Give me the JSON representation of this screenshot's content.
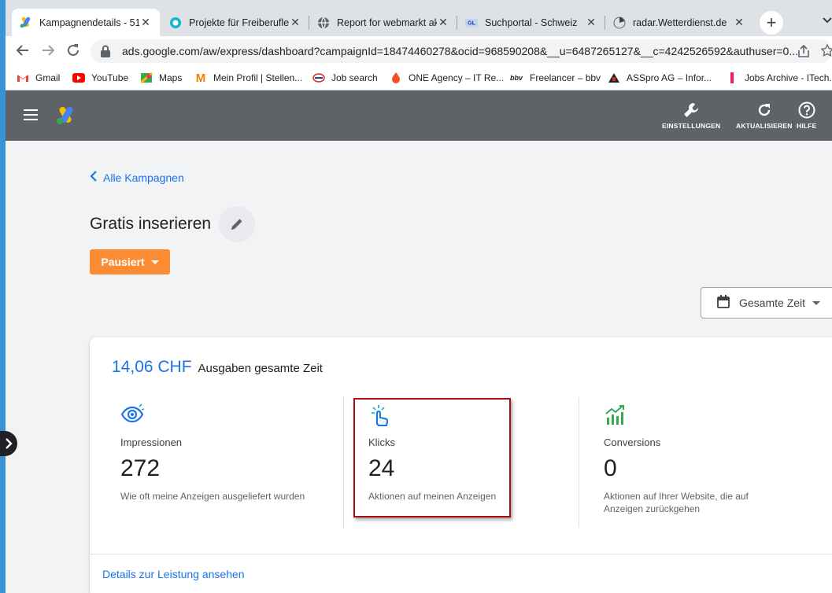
{
  "browser": {
    "tabs": [
      {
        "title": "Kampagnendetails - 51",
        "icon": "google-ads-icon",
        "active": true
      },
      {
        "title": "Projekte für Freiberufler",
        "icon": "freelance-icon",
        "active": false
      },
      {
        "title": "Report for webmarkt ak",
        "icon": "globe-icon",
        "active": false
      },
      {
        "title": "Suchportal - Schweiz",
        "icon": "portal-icon",
        "active": false
      },
      {
        "title": "radar.Wetterdienst.de",
        "icon": "radar-icon",
        "active": false
      }
    ],
    "close_glyph": "✕",
    "new_tab_glyph": "+",
    "url": "ads.google.com/aw/express/dashboard?campaignId=18474460278&ocid=968590208&__u=6487265127&__c=4242526592&authuser=0...",
    "bookmarks": [
      {
        "label": "Gmail",
        "icon": "gmail-icon"
      },
      {
        "label": "YouTube",
        "icon": "youtube-icon"
      },
      {
        "label": "Maps",
        "icon": "maps-icon"
      },
      {
        "label": "Mein Profil | Stellen...",
        "icon": "m-icon"
      },
      {
        "label": "Job search",
        "icon": "jobsearch-icon"
      },
      {
        "label": "ONE Agency – IT Re...",
        "icon": "one-agency-icon"
      },
      {
        "label": "Freelancer – bbv",
        "icon": "bbv-icon"
      },
      {
        "label": "ASSpro AG – Infor...",
        "icon": "asspro-icon"
      },
      {
        "label": "Jobs Archive - ITech...",
        "icon": "itech-icon"
      }
    ]
  },
  "appbar": {
    "actions": [
      {
        "label": "EINSTELLUNGEN",
        "icon": "wrench-icon"
      },
      {
        "label": "AKTUALISIEREN",
        "icon": "refresh-icon"
      },
      {
        "label": "HILFE",
        "icon": "help-icon"
      }
    ]
  },
  "campaign": {
    "back_label": "Alle Kampagnen",
    "title": "Gratis inserieren",
    "status": "Pausiert",
    "date_range": "Gesamte Zeit"
  },
  "summary": {
    "spend_amount": "14,06 CHF",
    "spend_label": "Ausgaben gesamte Zeit",
    "metrics": [
      {
        "label": "Impressionen",
        "value": "272",
        "description": "Wie oft meine Anzeigen ausgeliefert wurden",
        "icon": "eye-icon"
      },
      {
        "label": "Klicks",
        "value": "24",
        "description": "Aktionen auf meinen Anzeigen",
        "icon": "pointer-click-icon"
      },
      {
        "label": "Conversions",
        "value": "0",
        "description": "Aktionen auf Ihrer Website, die auf Anzeigen zurückgehen",
        "icon": "chart-up-icon"
      }
    ],
    "details_link": "Details zur Leistung ansehen"
  },
  "colors": {
    "accent_blue": "#1a73e8",
    "status_orange": "#fb8c33",
    "appbar_gray": "#5f6368",
    "highlight_red": "#a50e0e"
  }
}
